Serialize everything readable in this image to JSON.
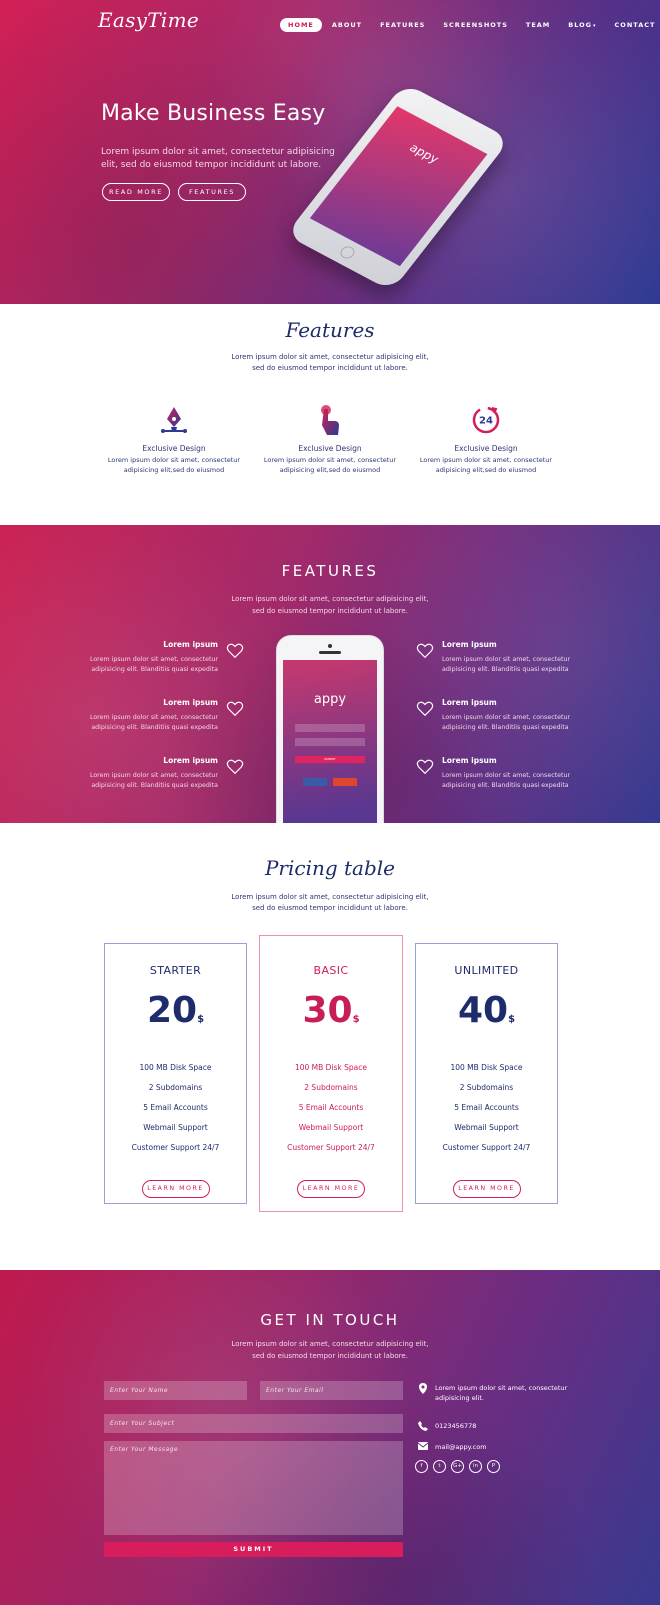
{
  "brand": {
    "logo": "EasyTime"
  },
  "nav": [
    {
      "label": "HOME",
      "active": true
    },
    {
      "label": "ABOUT"
    },
    {
      "label": "FEATURES"
    },
    {
      "label": "SCREENSHOTS"
    },
    {
      "label": "TEAM"
    },
    {
      "label": "BLOG"
    },
    {
      "label": "CONTACT"
    }
  ],
  "hero": {
    "title": "Make Business Easy",
    "subtitle": "Lorem ipsum dolor sit amet, consectetur adipisicing elit, sed do eiusmod tempor incididunt ut labore.",
    "read_more": "READ MORE",
    "features": "FEATURES",
    "phone_app_name": "appy"
  },
  "features_section": {
    "title": "Features",
    "description_line1": "Lorem ipsum dolor sit amet, consectetur adipisicing elit,",
    "description_line2": "sed do eiusmod tempor incididunt ut labore.",
    "items": [
      {
        "icon": "pen-nib-icon",
        "name": "Exclusive Design",
        "desc_line1": "Lorem ipsum dolor sit amet, consectetur",
        "desc_line2": "adipisicing elit,sed do eiusmod"
      },
      {
        "icon": "touch-hand-icon",
        "name": "Exclusive Design",
        "desc_line1": "Lorem ipsum dolor sit amet, consectetur",
        "desc_line2": "adipisicing elit,sed do eiusmod"
      },
      {
        "icon": "clock-24-icon",
        "name": "Exclusive Design",
        "desc_line1": "Lorem ipsum dolor sit amet, consectetur",
        "desc_line2": "adipisicing elit,sed do eiusmod"
      }
    ]
  },
  "features_showcase": {
    "title": "FEATURES",
    "description_line1": "Lorem ipsum dolor sit amet, consectetur adipisicing elit,",
    "description_line2": "sed do eiusmod tempor incididunt ut labore.",
    "phone_app_name": "appy",
    "phone_submit": "SUBMIT",
    "items": [
      {
        "title": "Lorem ipsum",
        "line1": "Lorem ipsum dolor sit amet, consectetur",
        "line2": "adipisicing elit. Blanditiis quasi expedita"
      },
      {
        "title": "Lorem ipsum",
        "line1": "Lorem ipsum dolor sit amet, consectetur",
        "line2": "adipisicing elit. Blanditiis quasi expedita"
      },
      {
        "title": "Lorem ipsum",
        "line1": "Lorem ipsum dolor sit amet, consectetur",
        "line2": "adipisicing elit. Blanditiis quasi expedita"
      },
      {
        "title": "Lorem ipsum",
        "line1": "Lorem ipsum dolor sit amet, consectetur",
        "line2": "adipisicing elit. Blanditiis quasi expedita"
      },
      {
        "title": "Lorem ipsum",
        "line1": "Lorem ipsum dolor sit amet, consectetur",
        "line2": "adipisicing elit. Blanditiis quasi expedita"
      },
      {
        "title": "Lorem ipsum",
        "line1": "Lorem ipsum dolor sit amet, consectetur",
        "line2": "adipisicing elit. Blanditiis quasi expedita"
      }
    ]
  },
  "pricing": {
    "title": "Pricing table",
    "description_line1": "Lorem ipsum dolor sit amet, consectetur adipisicing elit,",
    "description_line2": "sed do eiusmod tempor incididunt ut labore.",
    "plans": [
      {
        "name": "STARTER",
        "price": "20",
        "currency": "$",
        "features": [
          "100 MB Disk Space",
          "2 Subdomains",
          "5 Email Accounts",
          "Webmail Support",
          "Customer Support 24/7"
        ],
        "button": "LEARN MORE",
        "accent": "#1f2c6b",
        "border": "#9aa1d6"
      },
      {
        "name": "BASIC",
        "price": "30",
        "currency": "$",
        "features": [
          "100 MB Disk Space",
          "2 Subdomains",
          "5 Email Accounts",
          "Webmail Support",
          "Customer Support 24/7"
        ],
        "button": "LEARN MORE",
        "accent": "#c91d5a",
        "border": "#ee8fae",
        "highlighted": true
      },
      {
        "name": "UNLIMITED",
        "price": "40",
        "currency": "$",
        "features": [
          "100 MB Disk Space",
          "2 Subdomains",
          "5 Email Accounts",
          "Webmail Support",
          "Customer Support 24/7"
        ],
        "button": "LEARN MORE",
        "accent": "#1f2c6b",
        "border": "#9aa1d6"
      }
    ]
  },
  "contact": {
    "title": "GET IN TOUCH",
    "description_line1": "Lorem ipsum dolor sit amet, consectetur adipisicing elit,",
    "description_line2": "sed do eiusmod tempor incididunt ut labore.",
    "name_placeholder": "Enter Your Name",
    "email_placeholder": "Enter Your Email",
    "subject_placeholder": "Enter Your Subject",
    "message_placeholder": "Enter Your Message",
    "submit": "SUBMIT",
    "address": "Lorem ipsum dolor sit amet, consectetur adipisicing elit.",
    "phone": "0123456778",
    "email": "mail@appy.com",
    "social": [
      {
        "icon": "facebook-icon",
        "glyph": "f"
      },
      {
        "icon": "twitter-icon",
        "glyph": "t"
      },
      {
        "icon": "google-plus-icon",
        "glyph": "G+"
      },
      {
        "icon": "linkedin-icon",
        "glyph": "in"
      },
      {
        "icon": "pinterest-icon",
        "glyph": "P"
      }
    ]
  },
  "colors": {
    "brand_pink": "#d21f55",
    "brand_navy": "#1f2c6b",
    "gradient_purple": "#5a2f86",
    "gradient_blue": "#2d3a93"
  }
}
